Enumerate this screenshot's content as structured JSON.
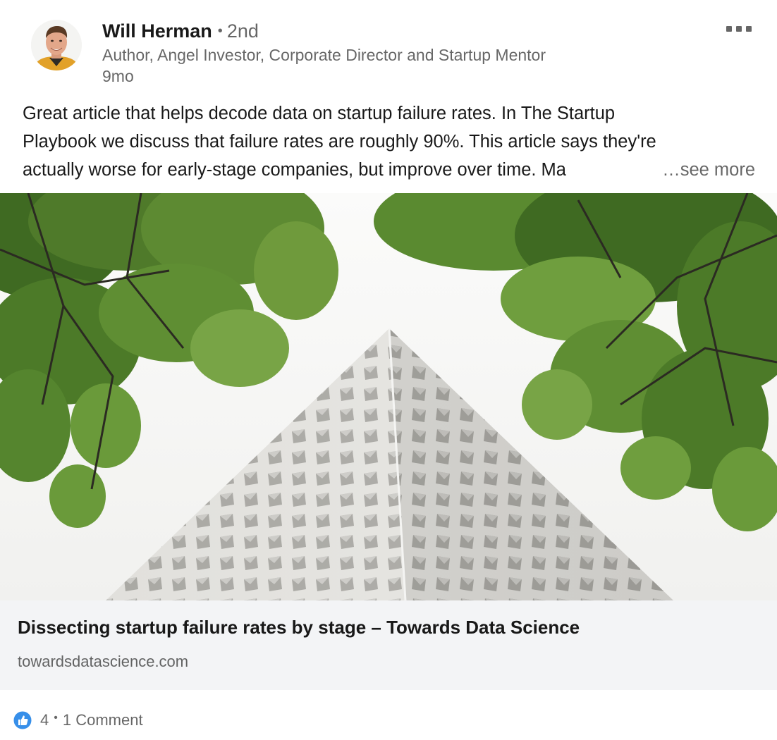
{
  "post": {
    "actor": {
      "name": "Will Herman",
      "degree": "2nd",
      "headline": "Author, Angel Investor, Corporate Director and Startup Mentor",
      "time": "9mo"
    },
    "commentary": {
      "lines": [
        "Great article that helps decode data on startup failure rates. In The Startup",
        "Playbook we discuss that failure rates are roughly 90%. This article says they're",
        "actually worse for early-stage companies, but improve over time. Ma"
      ],
      "see_more": "…see more"
    },
    "article": {
      "title": "Dissecting startup failure rates by stage – Towards Data Science",
      "source": "towardsdatascience.com"
    },
    "social": {
      "reactions": "4",
      "separator": "•",
      "comments": "1 Comment"
    }
  },
  "icons": {
    "more": "more-horizontal-icon",
    "like": "like-thumbs-up-icon"
  },
  "colors": {
    "like_blue": "#378fe9",
    "card_bg": "#ffffff",
    "article_bg": "#f3f4f6",
    "secondary_text": "#666666"
  }
}
